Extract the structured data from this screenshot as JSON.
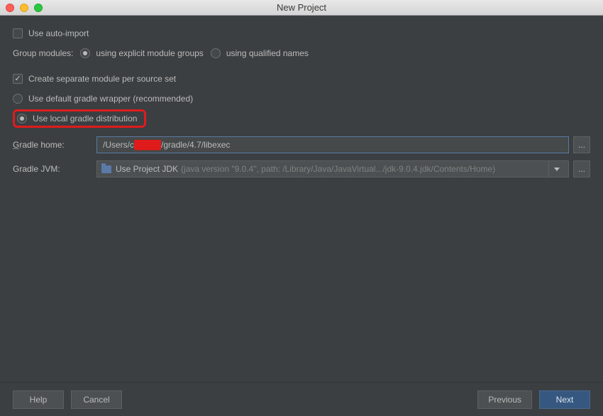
{
  "window": {
    "title": "New Project"
  },
  "options": {
    "auto_import": {
      "label": "Use auto-import",
      "checked": false
    },
    "group_modules": {
      "label": "Group modules:",
      "choices": {
        "explicit": "using explicit module groups",
        "qualified": "using qualified names"
      },
      "selected": "explicit"
    },
    "create_separate": {
      "label": "Create separate module per source set",
      "checked": true
    },
    "default_wrapper": {
      "label": "Use default gradle wrapper (recommended)",
      "selected": false
    },
    "local_distribution": {
      "label": "Use local gradle distribution",
      "selected": true
    }
  },
  "fields": {
    "gradle_home": {
      "label": "Gradle home:",
      "value_prefix": "/Users/c",
      "value_redacted": "████",
      "value_suffix": "/gradle/4.7/libexec"
    },
    "gradle_jvm": {
      "label": "Gradle JVM:",
      "selected": "Use Project JDK",
      "hint": "(java version \"9.0.4\", path: /Library/Java/JavaVirtual.../jdk-9.0.4.jdk/Contents/Home)"
    }
  },
  "buttons": {
    "help": "Help",
    "cancel": "Cancel",
    "previous": "Previous",
    "next": "Next",
    "ellipsis": "..."
  }
}
